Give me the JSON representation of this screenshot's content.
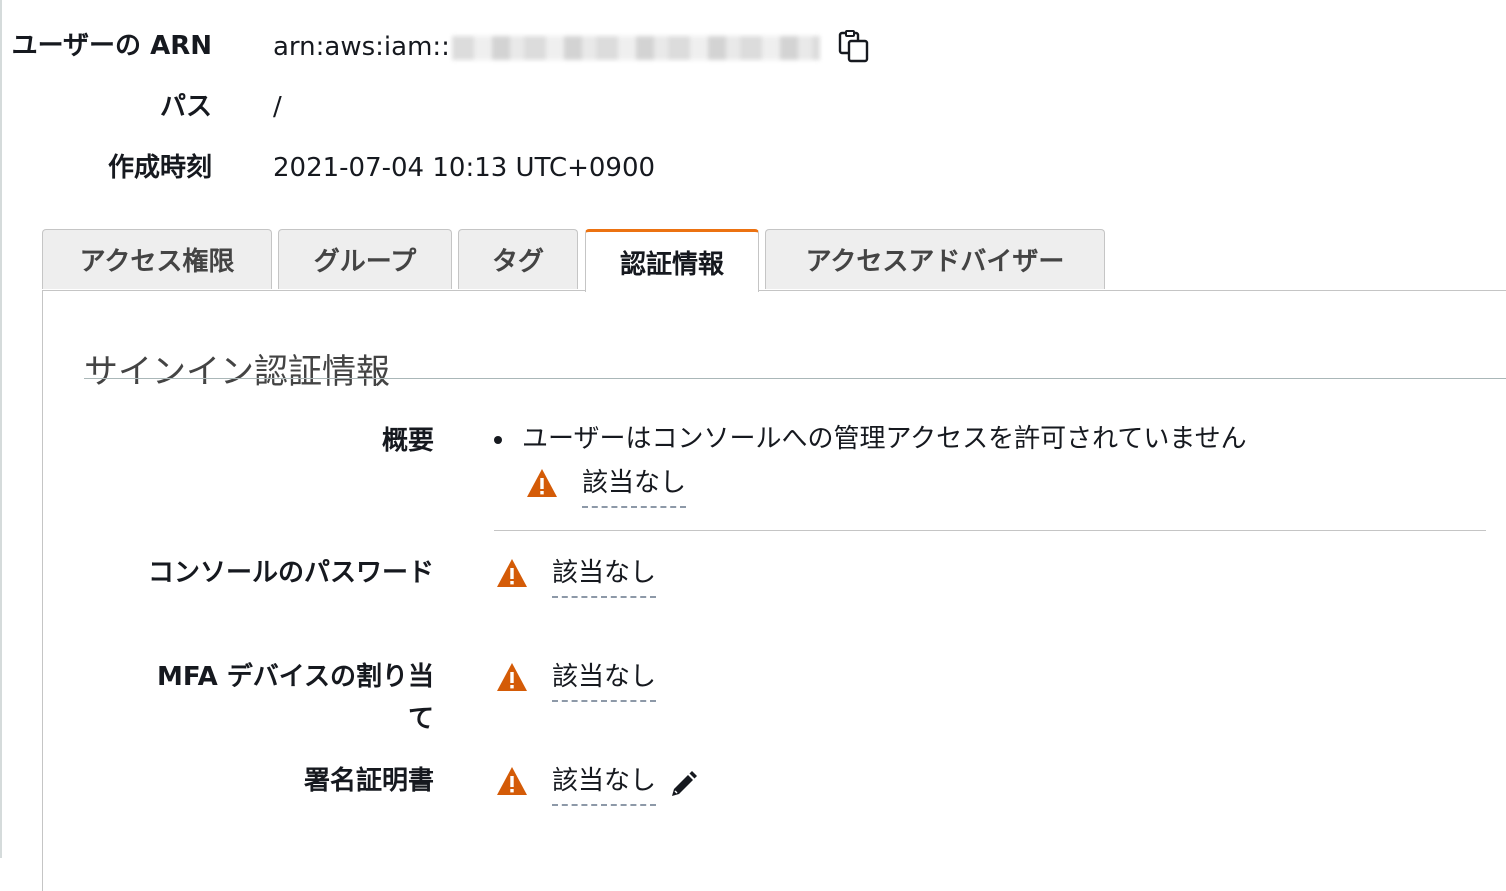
{
  "summary": {
    "arn_label": "ユーザーの ARN",
    "arn_value": "arn:aws:iam::",
    "path_label": "パス",
    "path_value": "/",
    "created_label": "作成時刻",
    "created_value": "2021-07-04 10:13 UTC+0900"
  },
  "tabs": [
    {
      "label": "アクセス権限"
    },
    {
      "label": "グループ"
    },
    {
      "label": "タグ"
    },
    {
      "label": "認証情報",
      "active": true
    },
    {
      "label": "アクセスアドバイザー"
    }
  ],
  "section": {
    "title": "サインイン認証情報",
    "rows": {
      "overview": {
        "label": "概要",
        "bullet": "ユーザーはコンソールへの管理アクセスを許可されていません",
        "value": "該当なし"
      },
      "console_password": {
        "label": "コンソールのパスワード",
        "value": "該当なし"
      },
      "mfa": {
        "label": "MFA デバイスの割り当て",
        "value": "該当なし"
      },
      "signing_cert": {
        "label": "署名証明書",
        "value": "該当なし"
      }
    }
  },
  "icons": {
    "copy": "copy-icon",
    "warning": "warning-icon",
    "edit": "pencil-icon"
  },
  "colors": {
    "accent": "#ec7211",
    "warning": "#d45b07"
  }
}
